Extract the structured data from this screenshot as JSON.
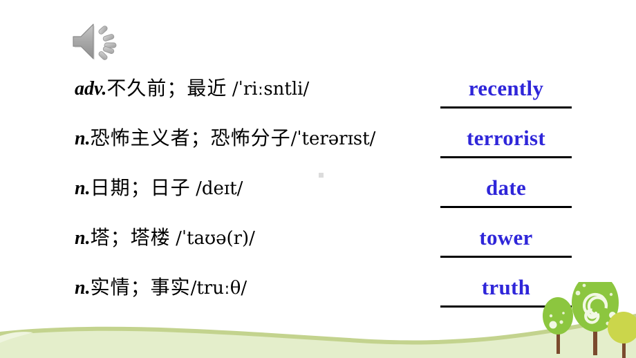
{
  "slide": {
    "title": "Vocabulary fill-in-the-blank slide",
    "audio_icon": "speaker-icon"
  },
  "colors": {
    "answer_text": "#2F26D9",
    "blank_line": "#000000",
    "definition_text": "#000000",
    "wave_light": "#E4EECB",
    "wave_edge": "#C8D79A",
    "tree_green": "#8CC63F",
    "tree_green_light": "#A6CE54",
    "tree_yellow": "#CBD64B",
    "trunk_brown": "#7B4A2D",
    "marker_grey": "#DCDCDC"
  },
  "entries": [
    {
      "pos": "adv.",
      "chinese": "不久前；最近",
      "ipa": "/ˈriːsntli/",
      "answer": "recently"
    },
    {
      "pos": "n.",
      "chinese": "恐怖主义者；恐怖分子",
      "ipa": "/ˈterərɪst/",
      "answer": "terrorist"
    },
    {
      "pos": "n.",
      "chinese": "日期；日子",
      "ipa": "/deɪt/",
      "answer": "date"
    },
    {
      "pos": "n.",
      "chinese": "塔；塔楼",
      "ipa": "/ˈtaʊə(r)/",
      "answer": "tower"
    },
    {
      "pos": "n.",
      "chinese": "实情；事实",
      "ipa": "/truːθ/",
      "answer": "truth"
    }
  ]
}
